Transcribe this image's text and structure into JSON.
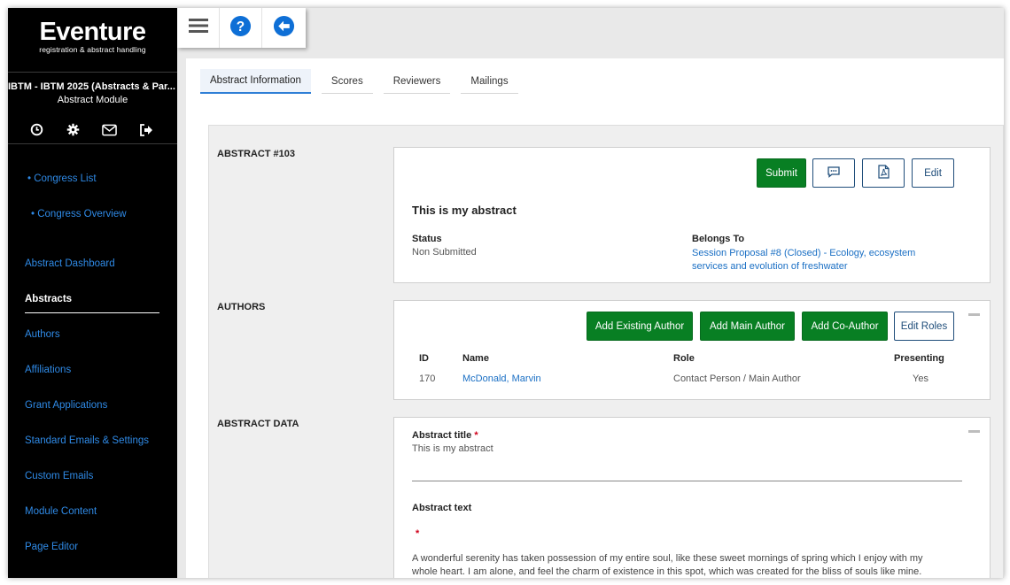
{
  "brand": {
    "name": "Eventure",
    "tagline": "registration & abstract handling"
  },
  "event": {
    "title": "IBTM - IBTM 2025 (Abstracts & Par...",
    "module": "Abstract Module"
  },
  "sidebar": {
    "icons": [
      "clock-icon",
      "gear-icon",
      "mail-icon",
      "logout-icon"
    ],
    "links": [
      {
        "label": "• Congress List"
      },
      {
        "label": "• Congress Overview"
      }
    ],
    "items": [
      {
        "label": "Abstract Dashboard"
      },
      {
        "label": "Abstracts",
        "active": true
      },
      {
        "label": "Authors"
      },
      {
        "label": "Affiliations"
      },
      {
        "label": "Grant Applications"
      },
      {
        "label": "Standard Emails & Settings"
      },
      {
        "label": "Custom Emails"
      },
      {
        "label": "Module Content"
      },
      {
        "label": "Page Editor"
      }
    ]
  },
  "toolbar": {
    "icons": [
      "menu-icon",
      "help-icon",
      "back-icon"
    ]
  },
  "tabs": [
    {
      "label": "Abstract Information",
      "active": true
    },
    {
      "label": "Scores"
    },
    {
      "label": "Reviewers"
    },
    {
      "label": "Mailings"
    }
  ],
  "abstract": {
    "section_label": "ABSTRACT #103",
    "buttons": {
      "submit": "Submit",
      "edit": "Edit"
    },
    "title": "This is my abstract",
    "status_label": "Status",
    "status_value": "Non Submitted",
    "belongs_label": "Belongs To",
    "belongs_line1": "Session Proposal #8 (Closed) - Ecology, ecosystem",
    "belongs_line2": "services and evolution of freshwater"
  },
  "authors": {
    "section_label": "AUTHORS",
    "buttons": {
      "add_existing": "Add Existing Author",
      "add_main": "Add Main Author",
      "add_co": "Add Co-Author",
      "edit_roles": "Edit Roles"
    },
    "columns": {
      "id": "ID",
      "name": "Name",
      "role": "Role",
      "presenting": "Presenting"
    },
    "rows": [
      {
        "id": "170",
        "name": "McDonald, Marvin",
        "role": "Contact Person / Main Author",
        "presenting": "Yes"
      }
    ]
  },
  "abstract_data": {
    "section_label": "ABSTRACT DATA",
    "title_label": "Abstract title",
    "title_value": "This is my abstract",
    "text_label": "Abstract text",
    "required_mark": "*",
    "text_line1": "A wonderful serenity has taken possession of my entire soul, like these sweet mornings of spring which I enjoy with my",
    "text_line2": "whole heart. I am alone, and feel the charm of existence in this spot, which was created for the bliss of souls like mine."
  },
  "colors": {
    "accent": "#1a6fc4",
    "green": "#087f23",
    "sidebar_bg": "#000000"
  }
}
